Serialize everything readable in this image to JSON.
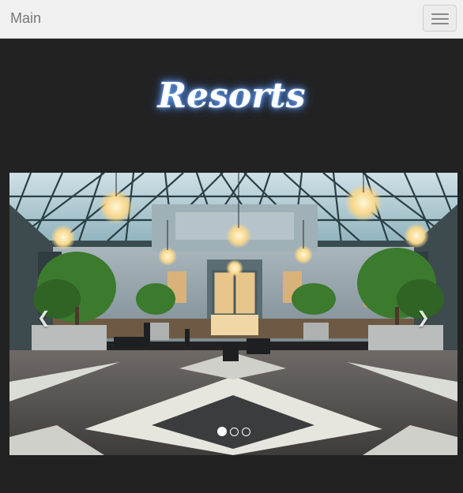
{
  "navbar": {
    "brand": "Main",
    "toggle_icon": "hamburger-icon"
  },
  "page": {
    "heading": "Resorts",
    "heading_glow_color": "#6fa6ff"
  },
  "carousel": {
    "prev_icon": "chevron-left-icon",
    "next_icon": "chevron-right-icon",
    "prev_glyph": "❮",
    "next_glyph": "❯",
    "slide_count": 3,
    "active_index": 0,
    "slide_image": "grand hotel atrium with glass roof, chandeliers and marble floor"
  },
  "colors": {
    "background": "#222222",
    "navbar": "#f0f0f0",
    "brand_text": "#777777"
  }
}
